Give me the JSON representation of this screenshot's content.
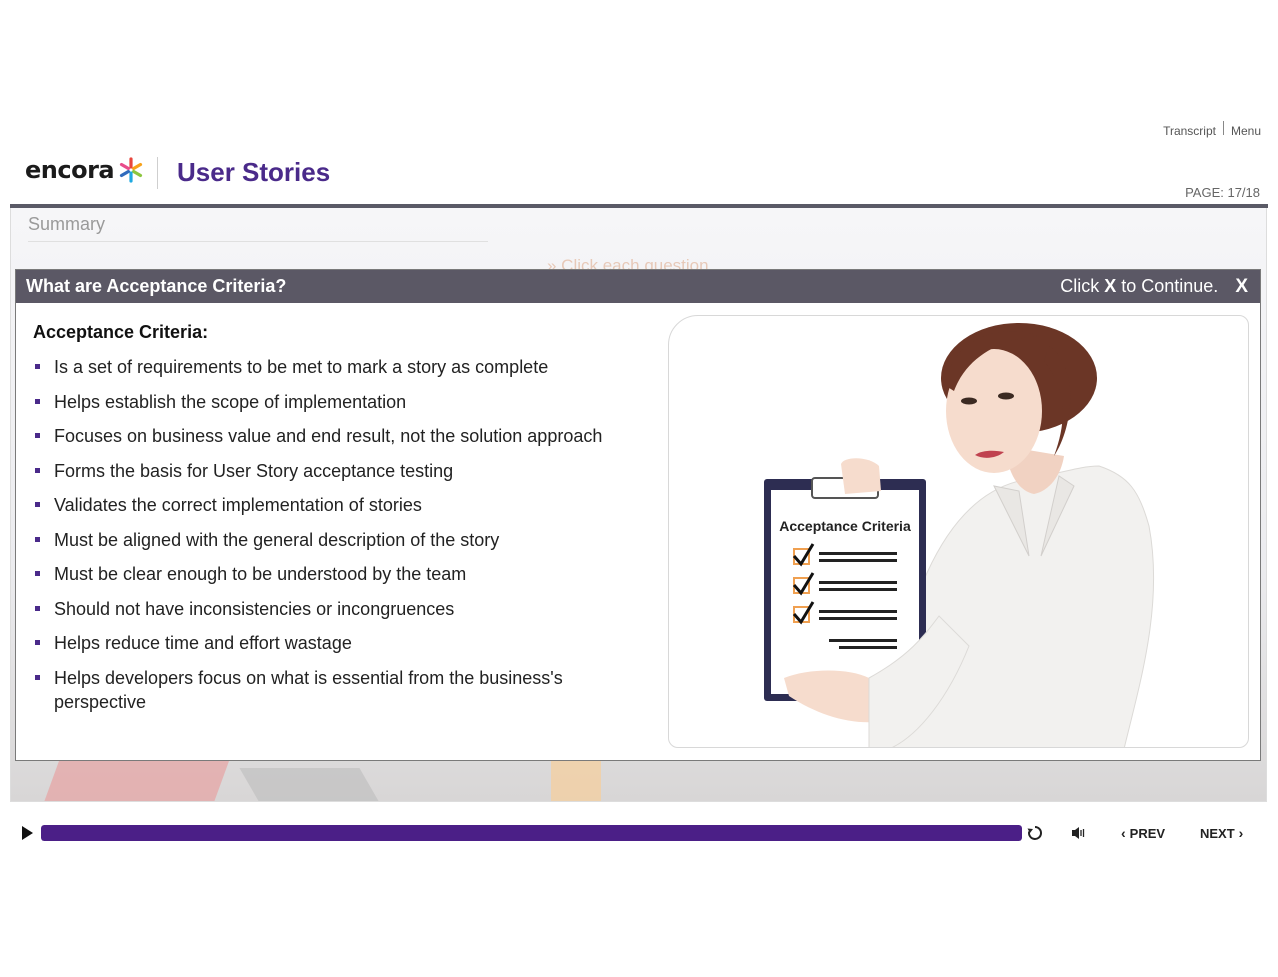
{
  "top_links": {
    "transcript": "Transcript",
    "menu": "Menu"
  },
  "brand": {
    "logo_text": "encora"
  },
  "header": {
    "course_title": "User Stories",
    "page_label": "PAGE: 17/18"
  },
  "stage": {
    "section_label": "Summary",
    "hint": "» Click each question"
  },
  "popup": {
    "title": "What are Acceptance Criteria?",
    "close_hint_pre": "Click ",
    "close_hint_key": "X",
    "close_hint_post": " to Continue.",
    "close_label": "X",
    "content_heading": "Acceptance Criteria:",
    "items": [
      "Is a set of requirements to be met to mark a story as complete",
      "Helps establish the scope of implementation",
      "Focuses on business value and end result, not the solution approach",
      "Forms the basis for User Story acceptance testing",
      "Validates the correct implementation of stories",
      "Must be aligned with the general description of the story",
      "Must be clear enough to be understood by the team",
      "Should not have inconsistencies or incongruences",
      "Helps reduce time and effort wastage",
      "Helps developers focus on what is essential from the business's perspective"
    ],
    "image": {
      "clipboard_title": "Acceptance Criteria"
    }
  },
  "controls": {
    "progress_fraction": 1.0,
    "prev_label": "PREV",
    "next_label": "NEXT"
  },
  "colors": {
    "brand_purple": "#4b1f87",
    "header_bar": "#5b5865"
  }
}
